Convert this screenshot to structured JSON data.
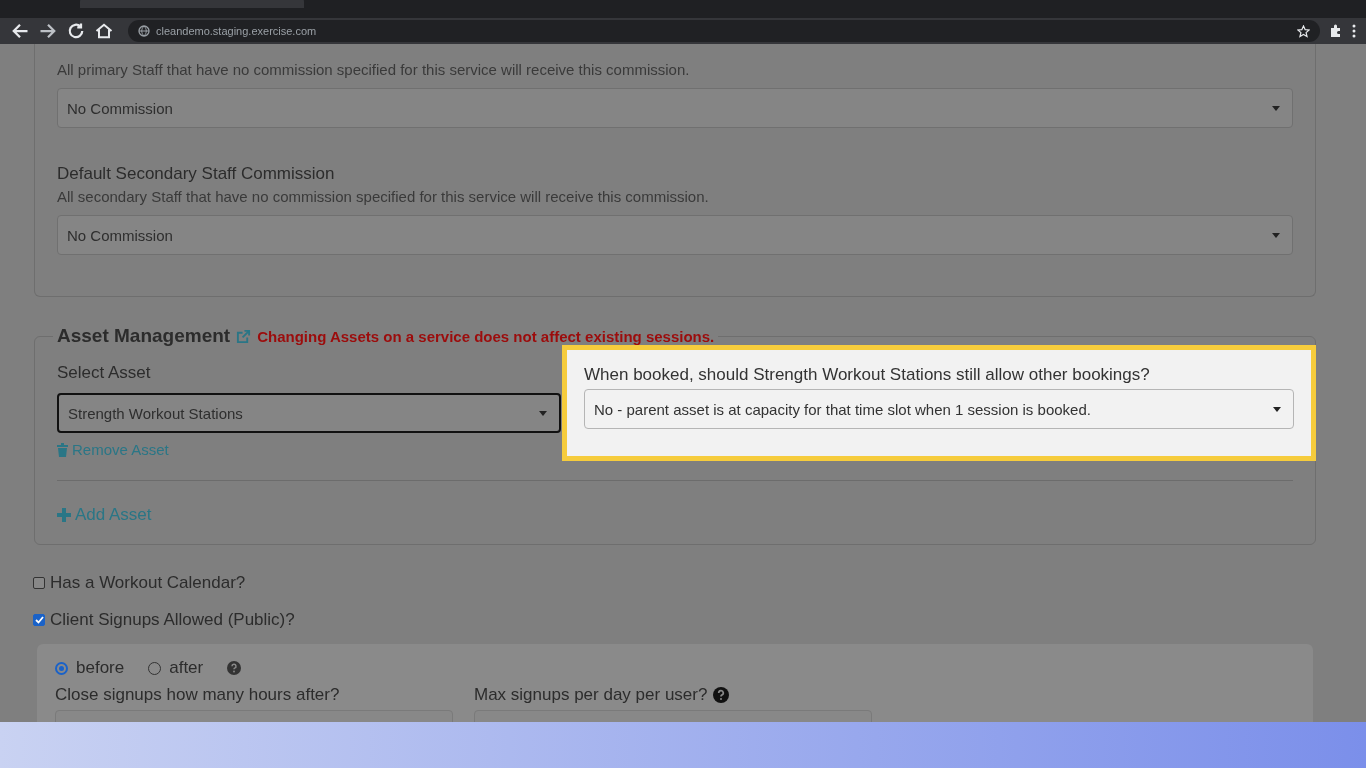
{
  "browser": {
    "url": "cleandemo.staging.exercise.com"
  },
  "commission": [
    {
      "help": "All primary Staff that have no commission specified for this service will receive this commission.",
      "value": "No Commission"
    },
    {
      "label": "Default Secondary Staff Commission",
      "help": "All secondary Staff that have no commission specified for this service will receive this commission.",
      "value": "No Commission"
    }
  ],
  "assets": {
    "title": "Asset Management",
    "warning": "Changing Assets on a service does not affect existing sessions.",
    "select_label": "Select Asset",
    "select_value": "Strength Workout Stations",
    "remove": "Remove Asset",
    "booking_question": "When booked, should Strength Workout Stations still allow other bookings?",
    "booking_value": "No - parent asset is at capacity for that time slot when 1 session is booked.",
    "add": "Add Asset"
  },
  "options": [
    {
      "label": "Has a Workout Calendar?",
      "checked": false
    },
    {
      "label": "Client Signups Allowed (Public)?",
      "checked": true
    }
  ],
  "signups": {
    "timing": [
      {
        "label": "before",
        "selected": true
      },
      {
        "label": "after",
        "selected": false
      }
    ],
    "fields": [
      {
        "label": "Close signups how many hours after?",
        "help_icon": false
      },
      {
        "label": "Max signups per day per user?",
        "help_icon": true
      }
    ]
  }
}
